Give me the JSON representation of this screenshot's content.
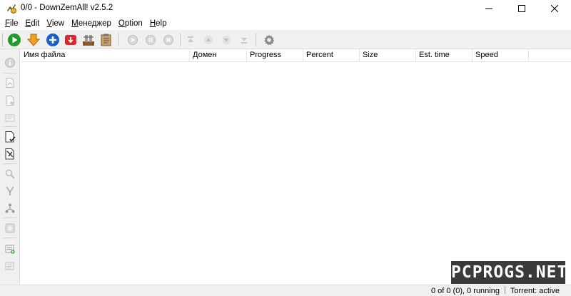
{
  "window": {
    "title": "0/0 - DownZemAll! v2.5.2"
  },
  "menu": [
    {
      "underline": "F",
      "rest": "ile"
    },
    {
      "underline": "E",
      "rest": "dit"
    },
    {
      "underline": "V",
      "rest": "iew"
    },
    {
      "underline": "М",
      "rest": "енеджер"
    },
    {
      "underline": "O",
      "rest": "ption"
    },
    {
      "underline": "H",
      "rest": "elp"
    }
  ],
  "columns": [
    "Имя файла",
    "Домен",
    "Progress",
    "Percent",
    "Size",
    "Est. time",
    "Speed"
  ],
  "status": {
    "downloads": "0 of 0 (0), 0 running",
    "torrent": "Torrent: active"
  },
  "watermark": "PCPROGS.NET",
  "colors": {
    "start_green": "#1f9a2c",
    "add_blue": "#1a5fc8",
    "stop_red": "#d7282d",
    "download_orange": "#f0a020"
  },
  "icons": {
    "toolbar": [
      "start-all-icon",
      "download-icon",
      "add-icon",
      "stop-icon",
      "batch-icon",
      "clipboard-icon",
      "resume-icon",
      "pause-icon",
      "cancel-icon",
      "move-top-icon",
      "move-up-icon",
      "move-down-icon",
      "move-bottom-icon",
      "settings-icon"
    ],
    "sidebar": [
      "info-icon",
      "open-file-icon",
      "open-folder-icon",
      "properties-icon",
      "select-completed-icon",
      "select-all-icon",
      "search-icon",
      "filter-icon",
      "network-icon",
      "scheduler-icon",
      "add-batch-icon",
      "remove-icon"
    ]
  }
}
